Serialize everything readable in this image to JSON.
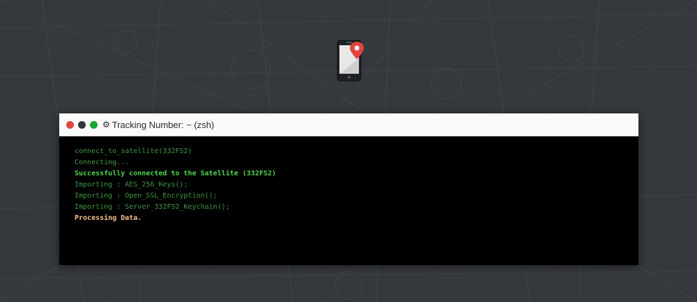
{
  "window": {
    "title": "Tracking Number: ~ (zsh)",
    "controls": [
      "close-dot",
      "minimize-dot",
      "maximize-dot"
    ]
  },
  "terminal": {
    "lines": [
      {
        "text": "connect_to_satellite(332FS2)",
        "style": "normal"
      },
      {
        "text": "Connecting...",
        "style": "normal"
      },
      {
        "text": "Successfully connected to the Satellite (332FS2)",
        "style": "success"
      },
      {
        "text": "Importing : AES_256_Keys();",
        "style": "normal"
      },
      {
        "text": "Importing : Open_SSL_Encryption();",
        "style": "normal"
      },
      {
        "text": "Importing : Server_332FS2_Keychain();",
        "style": "normal"
      },
      {
        "text": "Processing Data.",
        "style": "processing"
      }
    ]
  },
  "icons": {
    "app_icon": "phone-location-icon",
    "title_icon": "gear-icon"
  },
  "colors": {
    "background": "#35383c",
    "terminal_bg": "#000000",
    "text_normal": "#3f9a3f",
    "text_success": "#4ed64e",
    "text_processing": "#f6c28e",
    "dot_red": "#e0443e",
    "dot_dark": "#333538",
    "dot_green": "#1aa330",
    "pin_red": "#e0443e"
  }
}
